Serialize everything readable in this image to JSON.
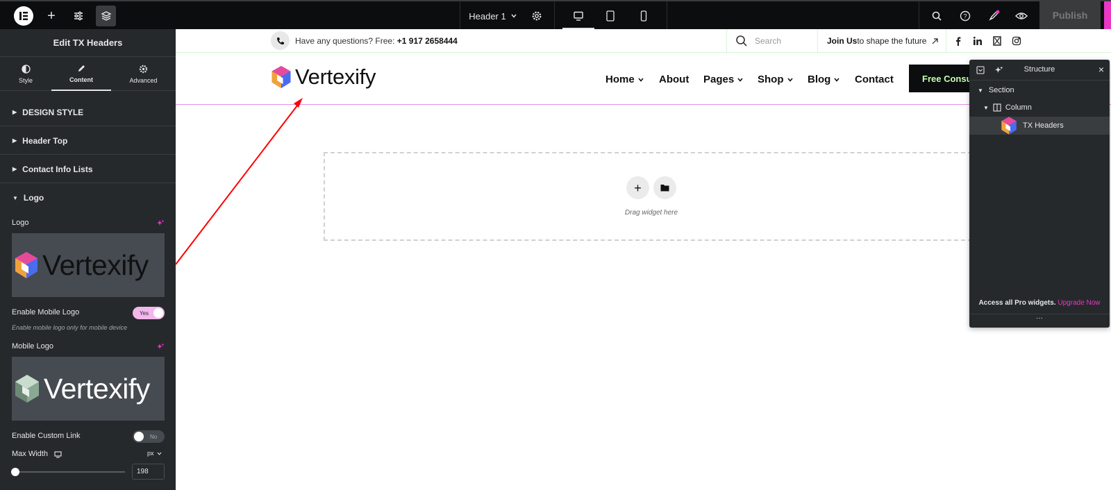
{
  "topbar": {
    "page_name": "Header 1",
    "publish_label": "Publish",
    "icons": [
      "elementor-logo-icon",
      "plus-icon",
      "sliders-icon",
      "layers-icon",
      "chevron-down-icon",
      "gear-icon",
      "desktop-icon",
      "tablet-icon",
      "mobile-icon",
      "search-icon",
      "help-icon",
      "rocket-icon",
      "eye-icon"
    ]
  },
  "sidebar": {
    "title": "Edit TX Headers",
    "tabs": [
      {
        "label": "Style",
        "icon": "half-circle-icon"
      },
      {
        "label": "Content",
        "icon": "pencil-icon"
      },
      {
        "label": "Advanced",
        "icon": "gear-icon"
      }
    ],
    "sections": [
      "DESIGN STYLE",
      "Header Top",
      "Contact Info Lists",
      "Logo"
    ],
    "logo_label": "Logo",
    "enable_mobile_logo_label": "Enable Mobile Logo",
    "enable_mobile_logo_value": "Yes",
    "mobile_logo_help": "Enable mobile logo only for mobile device",
    "mobile_logo_label": "Mobile Logo",
    "enable_custom_link_label": "Enable Custom Link",
    "enable_custom_link_value": "No",
    "max_width_label": "Max Width",
    "max_width_unit": "px",
    "max_width_value": "198",
    "preview_brand": "Vertexify"
  },
  "site": {
    "question_text": "Have any questions? Free: ",
    "phone": "+1 917 2658444",
    "search_placeholder": "Search",
    "join_bold": "Join Us",
    "join_rest": " to shape the future",
    "brand": "Vertexify",
    "nav": [
      "Home",
      "About",
      "Pages",
      "Shop",
      "Blog",
      "Contact"
    ],
    "cta": "Free Consul",
    "social": [
      "facebook-icon",
      "linkedin-icon",
      "x-icon",
      "instagram-icon"
    ]
  },
  "canvas": {
    "drop_label": "Drag widget here"
  },
  "structure": {
    "title": "Structure",
    "items": [
      "Section",
      "Column",
      "TX Headers"
    ],
    "promo_text": "Access all Pro widgets.",
    "promo_link": "Upgrade Now",
    "more": "···"
  },
  "colors": {
    "accent_pink": "#e838c4",
    "publish_bg": "#3a3b3d",
    "cta_bg": "#0c0d0e",
    "cta_text": "#c7ffb0",
    "arrow": "#ff0000"
  }
}
